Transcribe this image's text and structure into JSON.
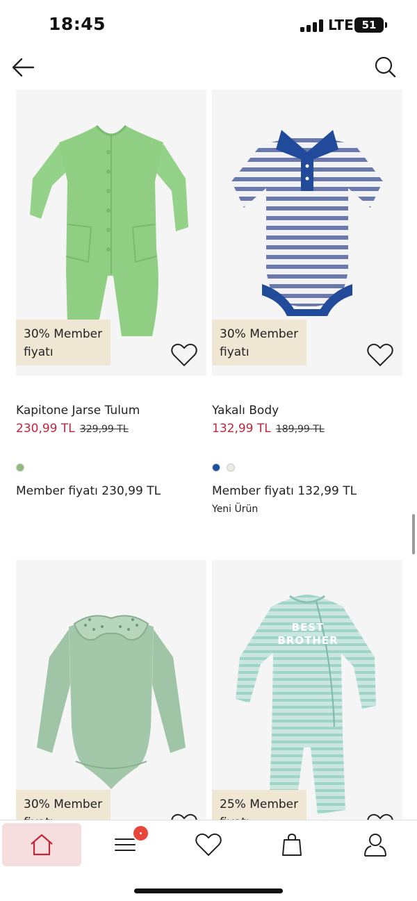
{
  "status_bar": {
    "time": "18:45",
    "network": "LTE",
    "battery": "51"
  },
  "header": {
    "back_icon": "arrow-left-icon",
    "search_icon": "search-icon"
  },
  "colors": {
    "sale": "#c0263a",
    "badge_bg": "#efe7d4",
    "nav_active_bg": "#f7dede",
    "notification": "#e8453c"
  },
  "products": [
    {
      "badge_line1": "30% Member",
      "badge_line2": "fiyatı",
      "name": "Kapitone Jarse Tulum",
      "price": "230,99 TL",
      "old_price": "329,99 TL",
      "swatches": [
        "#8dbd7c"
      ],
      "member_price": "Member fiyatı 230,99 TL",
      "tag": ""
    },
    {
      "badge_line1": "30% Member",
      "badge_line2": "fiyatı",
      "name": "Yakalı Body",
      "price": "132,99 TL",
      "old_price": "189,99 TL",
      "swatches": [
        "#1f4fa0",
        "#ecebe4"
      ],
      "member_price": "Member fiyatı 132,99 TL",
      "tag": "Yeni Ürün"
    },
    {
      "badge_line1": "30% Member",
      "badge_line2": "fiyatı"
    },
    {
      "badge_line1": "25% Member",
      "badge_line2": "fiyatı",
      "print_text": "BEST BROTHER"
    }
  ],
  "bottom_nav": {
    "items": [
      "home-icon",
      "menu-icon",
      "heart-icon",
      "shopping-bag-icon",
      "user-icon"
    ]
  }
}
